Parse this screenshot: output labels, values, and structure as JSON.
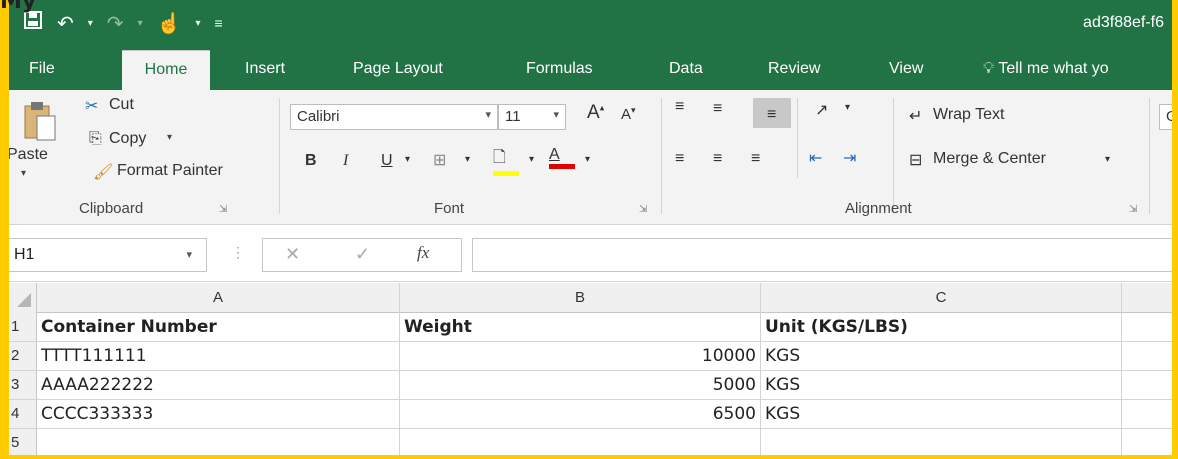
{
  "overlay_text": "My",
  "titlebar": {
    "document_title": "ad3f88ef-f6",
    "qat": {
      "save_icon": "save-icon",
      "undo_icon": "undo-icon",
      "redo_icon": "redo-icon",
      "touch_icon": "touch-mode-icon"
    }
  },
  "tabs": [
    {
      "label": "File",
      "active": false
    },
    {
      "label": "Home",
      "active": true
    },
    {
      "label": "Insert",
      "active": false
    },
    {
      "label": "Page Layout",
      "active": false
    },
    {
      "label": "Formulas",
      "active": false
    },
    {
      "label": "Data",
      "active": false
    },
    {
      "label": "Review",
      "active": false
    },
    {
      "label": "View",
      "active": false
    },
    {
      "label": "Tell me what yo",
      "active": false
    }
  ],
  "ribbon": {
    "clipboard": {
      "paste_label": "Paste",
      "cut_label": "Cut",
      "copy_label": "Copy",
      "format_painter_label": "Format Painter",
      "group_label": "Clipboard"
    },
    "font": {
      "font_name": "Calibri",
      "font_size": "11",
      "grow_label": "A",
      "shrink_label": "A",
      "bold_label": "B",
      "italic_label": "I",
      "underline_label": "U",
      "font_color_label": "A",
      "group_label": "Font",
      "fill_color": "#ffff00",
      "font_color": "#e00000"
    },
    "alignment": {
      "wrap_text_label": "Wrap Text",
      "merge_label": "Merge & Center",
      "group_label": "Alignment"
    },
    "number": {
      "partial_label": "G"
    }
  },
  "formula_bar": {
    "name_box": "H1",
    "fx_label": "fx",
    "formula": ""
  },
  "sheet": {
    "columns": [
      "A",
      "B",
      "C"
    ],
    "rows": [
      {
        "num": "1",
        "a": "Container Number",
        "b": "Weight",
        "c": "Unit (KGS/LBS)"
      },
      {
        "num": "2",
        "a": "TTTT111111",
        "b": "10000",
        "c": "KGS"
      },
      {
        "num": "3",
        "a": "AAAA222222",
        "b": "5000",
        "c": "KGS"
      },
      {
        "num": "4",
        "a": "CCCC333333",
        "b": "6500",
        "c": "KGS"
      },
      {
        "num": "5",
        "a": "",
        "b": "",
        "c": ""
      }
    ]
  },
  "colors": {
    "accent": "#217346",
    "frame": "#ffcc00"
  }
}
